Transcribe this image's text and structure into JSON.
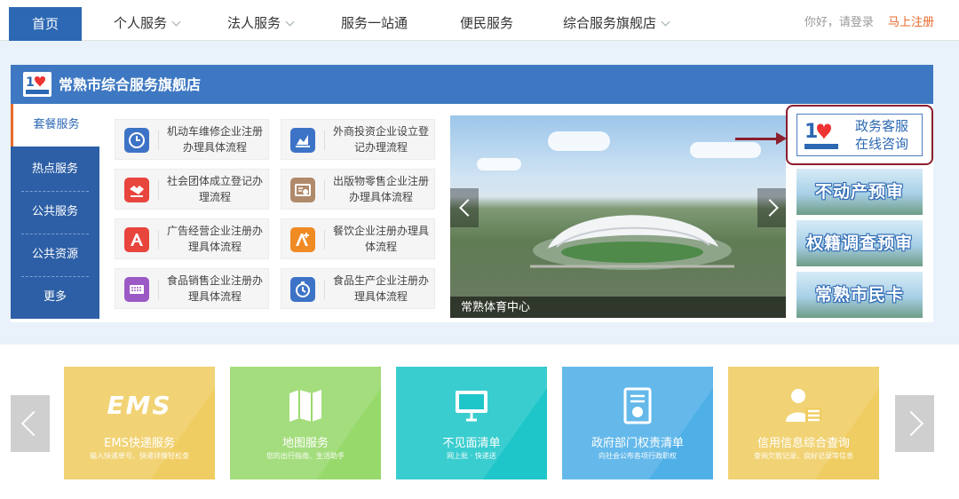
{
  "nav": {
    "items": [
      {
        "label": "首页",
        "dropdown": false
      },
      {
        "label": "个人服务",
        "dropdown": true
      },
      {
        "label": "法人服务",
        "dropdown": true
      },
      {
        "label": "服务一站通",
        "dropdown": false
      },
      {
        "label": "便民服务",
        "dropdown": false
      },
      {
        "label": "综合服务旗舰店",
        "dropdown": true
      }
    ],
    "login": "你好，请登录",
    "register": "马上注册"
  },
  "panel": {
    "title": "常熟市综合服务旗舰店"
  },
  "left_menu": [
    "套餐服务",
    "热点服务",
    "公共服务",
    "公共资源",
    "更多"
  ],
  "services": [
    {
      "label": "机动车维修企业注册办理具体流程",
      "icon": "clock-icon",
      "color": "#3d73c6"
    },
    {
      "label": "外商投资企业设立登记办理流程",
      "icon": "chart-icon",
      "color": "#3d73c6"
    },
    {
      "label": "社会团体成立登记办理流程",
      "icon": "handshake-icon",
      "color": "#e8453c"
    },
    {
      "label": "出版物零售企业注册办理具体流程",
      "icon": "certificate-icon",
      "color": "#b08a6a"
    },
    {
      "label": "广告经营企业注册办理具体流程",
      "icon": "ad-icon",
      "color": "#e8453c"
    },
    {
      "label": "餐饮企业注册办理具体流程",
      "icon": "ad-plus-icon",
      "color": "#f08a24"
    },
    {
      "label": "食品销售企业注册办理具体流程",
      "icon": "keyboard-icon",
      "color": "#9b59c6"
    },
    {
      "label": "食品生产企业注册办理具体流程",
      "icon": "stopwatch-icon",
      "color": "#3d73c6"
    }
  ],
  "carousel": {
    "caption": "常熟体育中心"
  },
  "customer_service": {
    "line1": "政务客服",
    "line2": "在线咨询"
  },
  "side_banners": [
    "不动产预审",
    "权籍调查预审",
    "常熟市民卡"
  ],
  "tiles": [
    {
      "title": "EMS快递服务",
      "sub": "输入快递单号、快递详情轻松查",
      "logo": "EMS",
      "icon": "ems-icon",
      "color": "#f0cd62"
    },
    {
      "title": "地图服务",
      "sub": "您的出行指南、生活助手",
      "icon": "map-icon",
      "color": "#98d96b"
    },
    {
      "title": "不见面清单",
      "sub": "网上批 · 快递送",
      "icon": "monitor-icon",
      "color": "#1fc6c9"
    },
    {
      "title": "政府部门权责清单",
      "sub": "向社会公布各项行政职权",
      "icon": "document-badge-icon",
      "color": "#4fb0e8"
    },
    {
      "title": "信用信息综合查询",
      "sub": "查询欠款记录、良好记录等信息",
      "icon": "user-card-icon",
      "color": "#f0cd62"
    }
  ]
}
